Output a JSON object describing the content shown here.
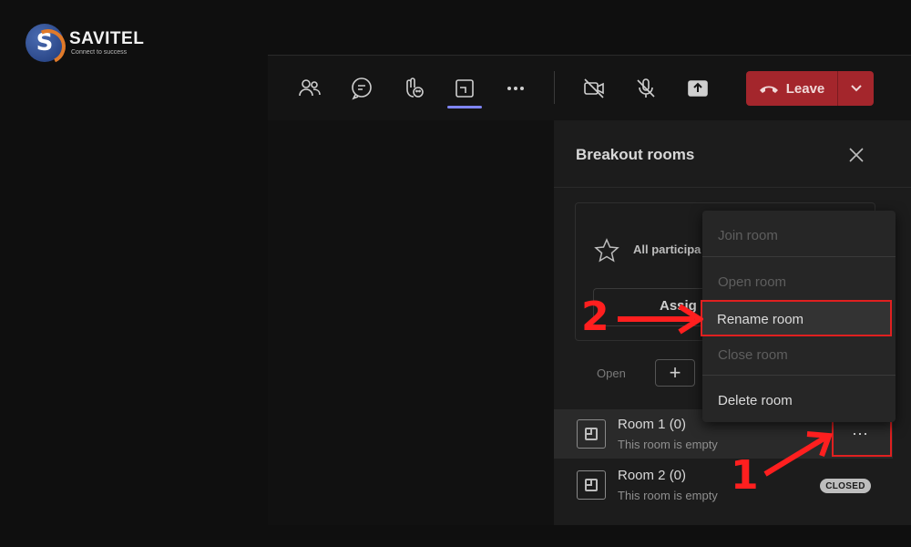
{
  "logo": {
    "name": "SAVITEL",
    "tagline": "Connect to success"
  },
  "toolbar": {
    "buttons": [
      "people-icon",
      "chat-icon",
      "reactions-icon",
      "rooms-icon",
      "more-icon",
      "camera-off-icon",
      "mic-off-icon",
      "share-icon"
    ],
    "leave_label": "Leave",
    "leave_color": "#a4262c"
  },
  "panel": {
    "title": "Breakout rooms",
    "assign_text": "All participa",
    "assign_button": "Assig",
    "open_label": "Open",
    "add_label": "+"
  },
  "rooms": [
    {
      "name": "Room 1  (0)",
      "status": "This room is empty",
      "more": "···"
    },
    {
      "name": "Room 2  (0)",
      "status": "This room is empty",
      "badge": "CLOSED"
    }
  ],
  "menu": {
    "items": [
      {
        "label": "Join room",
        "enabled": false
      },
      {
        "label": "Open room",
        "enabled": false
      },
      {
        "label": "Rename room",
        "enabled": true
      },
      {
        "label": "Close room",
        "enabled": false
      },
      {
        "label": "Delete room",
        "enabled": true
      }
    ]
  },
  "annotations": {
    "step1": "1",
    "step2": "2",
    "highlight_color": "#e02020"
  }
}
